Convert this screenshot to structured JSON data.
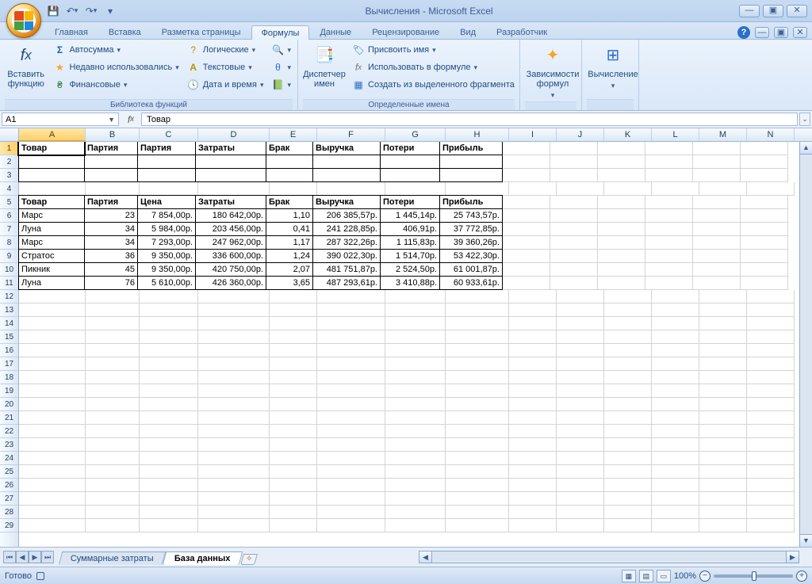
{
  "title": "Вычисления - Microsoft Excel",
  "qat": {
    "save": "💾",
    "undo": "↶",
    "redo": "↷"
  },
  "tabs": [
    "Главная",
    "Вставка",
    "Разметка страницы",
    "Формулы",
    "Данные",
    "Рецензирование",
    "Вид",
    "Разработчик"
  ],
  "active_tab": 3,
  "ribbon": {
    "g1": {
      "label": "Библиотека функций",
      "insert_function": "Вставить\nфункцию",
      "autosum": "Автосумма",
      "recent": "Недавно использовались",
      "financial": "Финансовые",
      "logical": "Логические",
      "text": "Текстовые",
      "datetime": "Дата и время",
      "lookup": "🔍",
      "math": "θ",
      "more": "⋯"
    },
    "g2": {
      "label": "Определенные имена",
      "name_manager": "Диспетчер\nимен",
      "define": "Присвоить имя",
      "use": "Использовать в формуле",
      "create": "Создать из выделенного фрагмента"
    },
    "g3": {
      "label": "",
      "btn": "Зависимости\nформул"
    },
    "g4": {
      "label": "",
      "btn": "Вычисление"
    }
  },
  "namebox": "A1",
  "formula": "Товар",
  "columns": [
    "A",
    "B",
    "C",
    "D",
    "E",
    "F",
    "G",
    "H",
    "I",
    "J",
    "K",
    "L",
    "M",
    "N"
  ],
  "row_count": 29,
  "headers1": [
    "Товар",
    "Партия",
    "Партия",
    "Затраты",
    "Брак",
    "Выручка",
    "Потери",
    "Прибыль"
  ],
  "headers2": [
    "Товар",
    "Партия",
    "Цена",
    "Затраты",
    "Брак",
    "Выручка",
    "Потери",
    "Прибыль"
  ],
  "rows": [
    [
      "Марс",
      "23",
      "7 854,00р.",
      "180 642,00р.",
      "1,10",
      "206 385,57р.",
      "1 445,14р.",
      "25 743,57р."
    ],
    [
      "Луна",
      "34",
      "5 984,00р.",
      "203 456,00р.",
      "0,41",
      "241 228,85р.",
      "406,91р.",
      "37 772,85р."
    ],
    [
      "Марс",
      "34",
      "7 293,00р.",
      "247 962,00р.",
      "1,17",
      "287 322,26р.",
      "1 115,83р.",
      "39 360,26р."
    ],
    [
      "Стратос",
      "36",
      "9 350,00р.",
      "336 600,00р.",
      "1,24",
      "390 022,30р.",
      "1 514,70р.",
      "53 422,30р."
    ],
    [
      "Пикник",
      "45",
      "9 350,00р.",
      "420 750,00р.",
      "2,07",
      "481 751,87р.",
      "2 524,50р.",
      "61 001,87р."
    ],
    [
      "Луна",
      "76",
      "5 610,00р.",
      "426 360,00р.",
      "3,65",
      "487 293,61р.",
      "3 410,88р.",
      "60 933,61р."
    ]
  ],
  "sheet_tabs": [
    "Суммарные затраты",
    "База данных"
  ],
  "active_sheet": 1,
  "status": {
    "ready": "Готово",
    "zoom": "100%"
  }
}
